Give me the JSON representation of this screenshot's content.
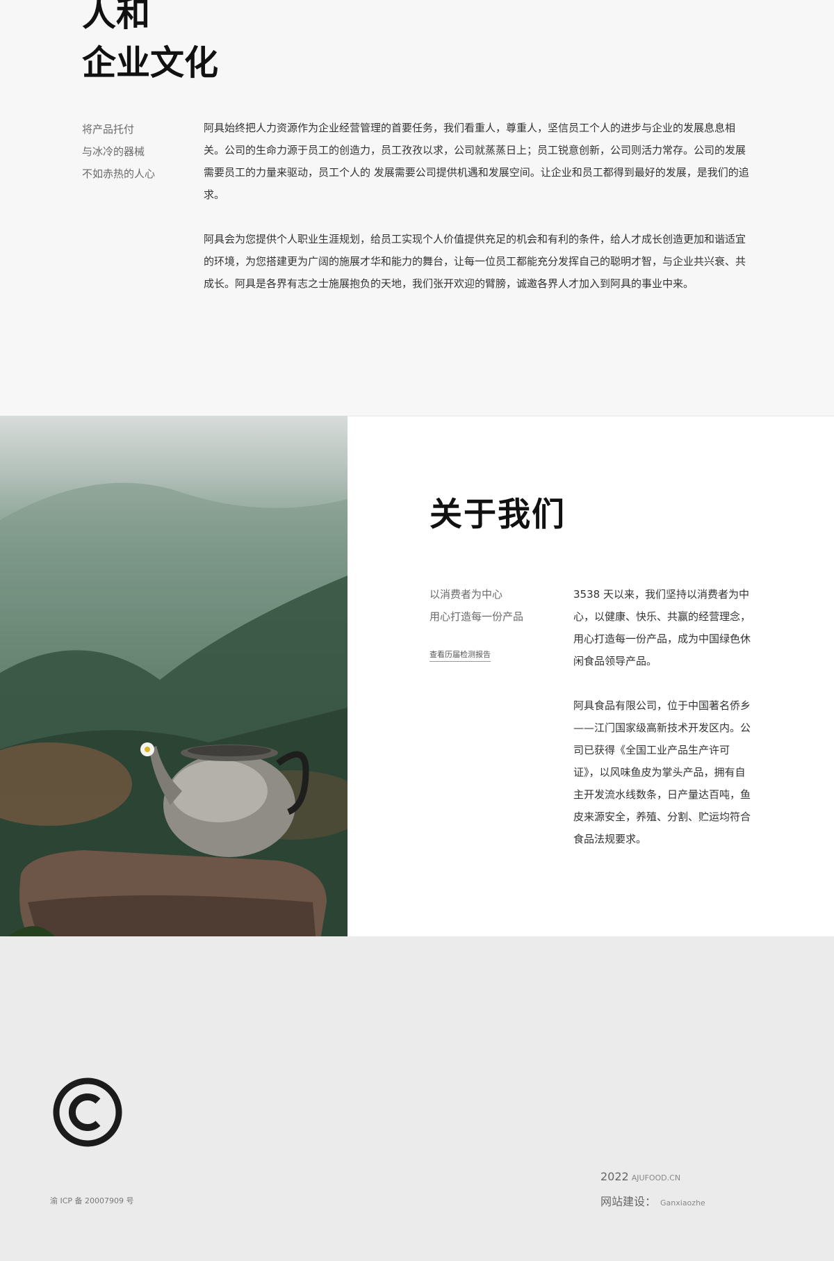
{
  "culture": {
    "title_line1": "人和",
    "title_line2": "企业文化",
    "side_lines": [
      "将产品托付",
      "与冰冷的器械",
      "不如赤热的人心"
    ],
    "paragraphs": [
      "阿具始终把人力资源作为企业经营管理的首要任务，我们看重人，尊重人，坚信员工个人的进步与企业的发展息息相关。公司的生命力源于员工的创造力，员工孜孜以求，公司就蒸蒸日上；员工锐意创新，公司则活力常存。公司的发展需要员工的力量来驱动，员工个人的 发展需要公司提供机遇和发展空间。让企业和员工都得到最好的发展，是我们的追求。",
      "阿具会为您提供个人职业生涯规划，给员工实现个人价值提供充足的机会和有利的条件，给人才成长创造更加和谐适宜的环境，为您搭建更为广阔的施展才华和能力的舞台，让每一位员工都能充分发挥自己的聪明才智，与企业共兴衰、共成长。阿具是各界有志之士施展抱负的天地，我们张开欢迎的臂膀，诚邀各界人才加入到阿具的事业中来。"
    ]
  },
  "about": {
    "title": "关于我们",
    "slogan_line1": "以消费者为中心",
    "slogan_line2": "用心打造每一份产品",
    "report_link": "查看历届检测报告",
    "paragraphs": [
      "3538 天以来，我们坚持以消费者为中心，以健康、快乐、共赢的经营理念，用心打造每一份产品，成为中国绿色休闲食品领导产品。",
      "阿具食品有限公司，位于中国著名侨乡——江门国家级高新技术开发区内。公司已获得《全国工业产品生产许可证》，以风味鱼皮为掌头产品，拥有自主开发流水线数条，日产量达百吨，鱼皮来源安全，养殖、分割、贮运均符合食品法规要求。"
    ]
  },
  "footer": {
    "icp": "渝 ICP 备 20007909 号",
    "year": "2022",
    "domain": "AJUFOOD.CN",
    "builder_label": "网站建设：",
    "builder_name": "Ganxiaozhe"
  }
}
